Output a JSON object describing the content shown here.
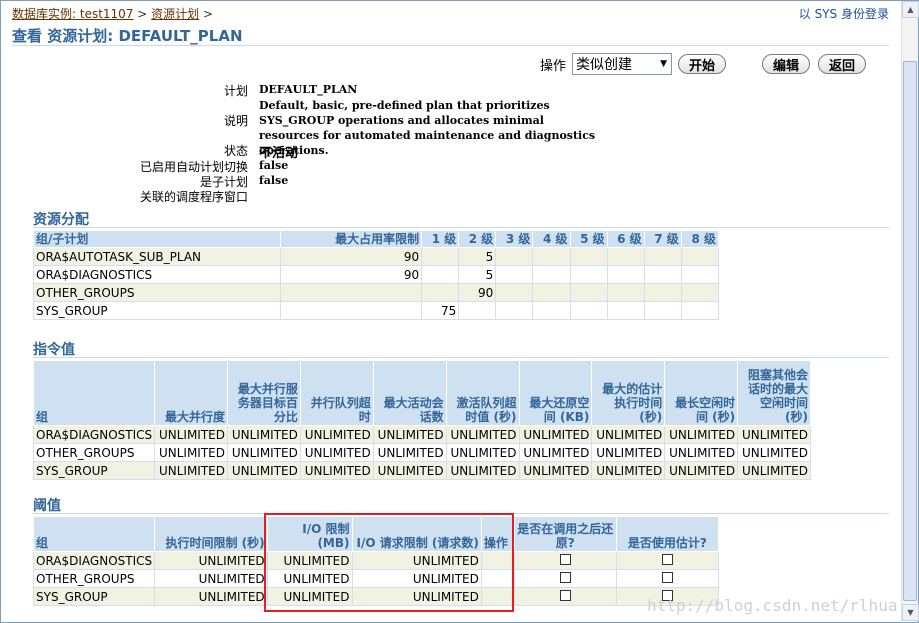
{
  "breadcrumb": {
    "db_instance": "数据库实例: test1107",
    "separator": ">",
    "resource_plans": "资源计划"
  },
  "login": "以 SYS 身份登录",
  "page_title": "查看 资源计划: DEFAULT_PLAN",
  "actions": {
    "label": "操作",
    "select_value": "类似创建",
    "go": "开始",
    "edit": "编辑",
    "back": "返回"
  },
  "props": {
    "plan_label": "计划",
    "plan_value": "DEFAULT_PLAN",
    "desc_label": "说明",
    "desc_value": "Default, basic, pre-defined plan that prioritizes SYS_GROUP operations and allocates minimal resources for automated maintenance and diagnostics operations.",
    "status_label": "状态",
    "status_value": "不活动",
    "auto_switch_label": "已启用自动计划切换",
    "auto_switch_value": "false",
    "subplan_label": "是子计划",
    "subplan_value": "false",
    "window_label": "关联的调度程序窗口",
    "window_value": ""
  },
  "allocation": {
    "title": "资源分配",
    "headers": [
      "组/子计划",
      "最大占用率限制",
      "1 级",
      "2 级",
      "3 级",
      "4 级",
      "5 级",
      "6 级",
      "7 级",
      "8 级"
    ],
    "rows": [
      [
        "ORA$AUTOTASK_SUB_PLAN",
        "90",
        "",
        "5",
        "",
        "",
        "",
        "",
        "",
        ""
      ],
      [
        "ORA$DIAGNOSTICS",
        "90",
        "",
        "5",
        "",
        "",
        "",
        "",
        "",
        ""
      ],
      [
        "OTHER_GROUPS",
        "",
        "",
        "90",
        "",
        "",
        "",
        "",
        "",
        ""
      ],
      [
        "SYS_GROUP",
        "",
        "75",
        "",
        "",
        "",
        "",
        "",
        "",
        ""
      ]
    ]
  },
  "directives": {
    "title": "指令值",
    "headers": [
      "组",
      "最大并行度",
      "最大并行服务器目标百分比",
      "并行队列超时",
      "最大活动会话数",
      "激活队列超时值 (秒)",
      "最大还原空间 (KB)",
      "最大的估计执行时间 (秒)",
      "最长空闲时间 (秒)",
      "阻塞其他会话时的最大空闲时间 (秒)"
    ],
    "rows": [
      [
        "ORA$DIAGNOSTICS",
        "UNLIMITED",
        "UNLIMITED",
        "UNLIMITED",
        "UNLIMITED",
        "UNLIMITED",
        "UNLIMITED",
        "UNLIMITED",
        "UNLIMITED",
        "UNLIMITED"
      ],
      [
        "OTHER_GROUPS",
        "UNLIMITED",
        "UNLIMITED",
        "UNLIMITED",
        "UNLIMITED",
        "UNLIMITED",
        "UNLIMITED",
        "UNLIMITED",
        "UNLIMITED",
        "UNLIMITED"
      ],
      [
        "SYS_GROUP",
        "UNLIMITED",
        "UNLIMITED",
        "UNLIMITED",
        "UNLIMITED",
        "UNLIMITED",
        "UNLIMITED",
        "UNLIMITED",
        "UNLIMITED",
        "UNLIMITED"
      ]
    ]
  },
  "thresholds": {
    "title": "阈值",
    "headers": [
      "组",
      "执行时间限制 (秒)",
      "I/O 限制 (MB)",
      "I/O 请求限制 (请求数)",
      "操作",
      "是否在调用之后还原?",
      "是否使用估计?"
    ],
    "rows": [
      [
        "ORA$DIAGNOSTICS",
        "UNLIMITED",
        "UNLIMITED",
        "UNLIMITED",
        ""
      ],
      [
        "OTHER_GROUPS",
        "UNLIMITED",
        "UNLIMITED",
        "UNLIMITED",
        ""
      ],
      [
        "SYS_GROUP",
        "UNLIMITED",
        "UNLIMITED",
        "UNLIMITED",
        ""
      ]
    ]
  },
  "watermark": "http://blog.csdn.net/rlhua"
}
